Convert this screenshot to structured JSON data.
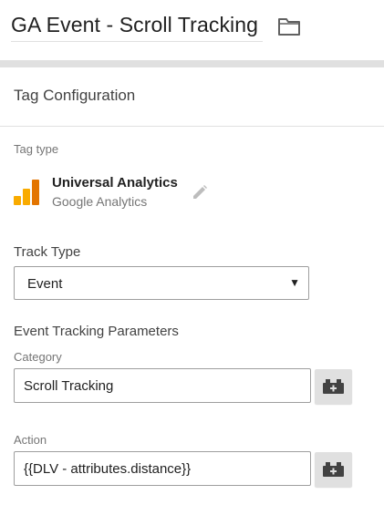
{
  "header": {
    "tag_name": "GA Event - Scroll Tracking",
    "folder_icon": "folder-icon"
  },
  "card": {
    "title": "Tag Configuration",
    "tag_type_label": "Tag type",
    "tag_type": {
      "name": "Universal Analytics",
      "vendor": "Google Analytics",
      "logo_icon": "universal-analytics-logo",
      "edit_icon": "pencil-icon"
    },
    "track_type": {
      "label": "Track Type",
      "value": "Event",
      "arrow": "▼"
    },
    "params_title": "Event Tracking Parameters",
    "category": {
      "label": "Category",
      "value": "Scroll Tracking",
      "variable_icon": "variable-block-icon"
    },
    "action": {
      "label": "Action",
      "value": "{{DLV - attributes.distance}}",
      "variable_icon": "variable-block-icon"
    }
  },
  "colors": {
    "ga_orange": "#F9AB00",
    "ga_dark_orange": "#E37400",
    "shade": "#E0E0E0"
  }
}
